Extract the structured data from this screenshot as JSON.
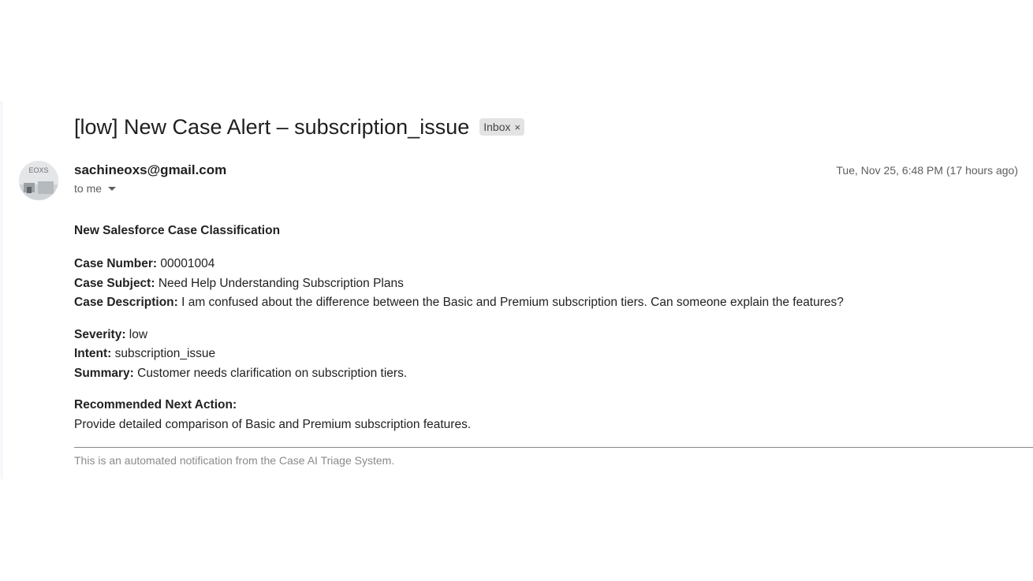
{
  "email": {
    "subject": "[low] New Case Alert – subscription_issue",
    "label_chip": "Inbox",
    "label_remove_glyph": "×",
    "sender": "sachineoxs@gmail.com",
    "recipient": "to me",
    "date": "Tue, Nov 25, 6:48 PM (17 hours ago)",
    "avatar_text": "EOXS"
  },
  "message": {
    "heading": "New Salesforce Case Classification",
    "case": {
      "number_label": "Case Number:",
      "number_value": " 00001004",
      "subject_label": "Case Subject:",
      "subject_value": " Need Help Understanding Subscription Plans",
      "description_label": "Case Description:",
      "description_value": " I am confused about the difference between the Basic and Premium subscription tiers. Can someone explain the features?"
    },
    "classification": {
      "severity_label": "Severity:",
      "severity_value": " low",
      "intent_label": "Intent:",
      "intent_value": " subscription_issue",
      "summary_label": "Summary:",
      "summary_value": " Customer needs clarification on subscription tiers."
    },
    "recommendation": {
      "label": "Recommended Next Action:",
      "value": "Provide detailed comparison of Basic and Premium subscription features."
    },
    "footer": "This is an automated notification from the Case AI Triage System."
  }
}
